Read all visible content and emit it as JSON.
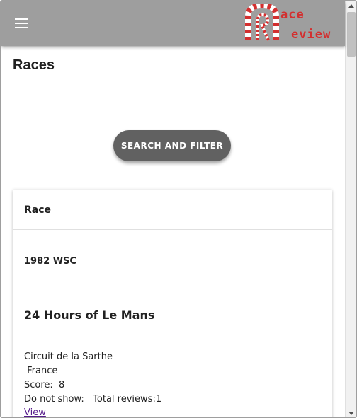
{
  "appbar": {
    "menu_icon": "menu-icon",
    "logo": {
      "top": "ace",
      "bottom": "eview"
    }
  },
  "page": {
    "title": "Races"
  },
  "search": {
    "label": "SEARCH AND FILTER"
  },
  "card": {
    "header": "Race",
    "series": "1982 WSC",
    "race_name": "24 Hours of Le Mans",
    "circuit": "Circuit de la Sarthe",
    "country": " France",
    "score": "Score:  8",
    "reviews": "Do not show:   Total reviews:1",
    "view_label": "View"
  },
  "colors": {
    "appbar": "#9e9e9e",
    "button": "#616161",
    "logo": "#d32f2f",
    "link": "#551a8b"
  }
}
